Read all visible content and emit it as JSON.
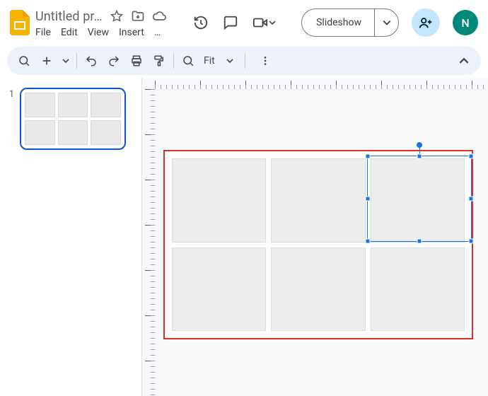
{
  "header": {
    "doc_title": "Untitled pr…",
    "menus": [
      "File",
      "Edit",
      "View",
      "Insert",
      "…"
    ],
    "slideshow_label": "Slideshow",
    "account_initial": "N"
  },
  "toolbar": {
    "zoom_label": "Fit"
  },
  "thumbnails": {
    "items": [
      {
        "number": "1"
      }
    ]
  },
  "colors": {
    "brand_accent": "#1a73e8",
    "selection_border": "#d93025",
    "share_bg": "#c2e7ff",
    "account_bg": "#00897b"
  }
}
